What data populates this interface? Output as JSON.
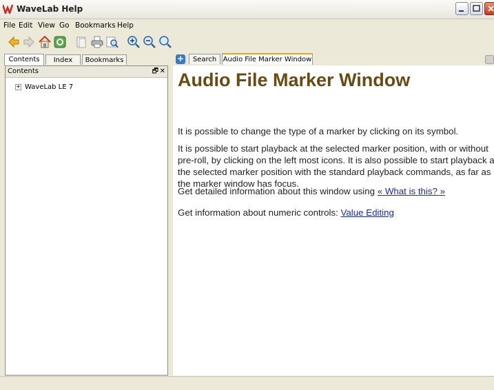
{
  "window": {
    "title": "WaveLab Help"
  },
  "menu": [
    "File",
    "Edit",
    "View",
    "Go",
    "Bookmarks",
    "Help"
  ],
  "toolbar": {
    "icons": [
      "back-arrow-icon",
      "forward-arrow-icon",
      "home-icon",
      "sync-icon",
      "previous-page-icon",
      "print-icon",
      "find-icon",
      "zoom-in-icon",
      "zoom-out-icon",
      "zoom-reset-icon"
    ]
  },
  "left_tabs": [
    "Contents",
    "Index",
    "Bookmarks"
  ],
  "left_panel": {
    "header": "Contents",
    "float_glyph": "🗗",
    "close_glyph": "✕",
    "tree": [
      {
        "expander": "+",
        "label": "WaveLab LE 7"
      }
    ]
  },
  "right_tabs": [
    "Search",
    "Audio File Marker Window"
  ],
  "content": {
    "heading": "Audio File Marker Window",
    "p1": "It is possible to change the type of a marker by clicking on its symbol.",
    "p2": "It is possible to start playback at the selected marker position, with or without pre-roll, by clicking on the left most icons. It is also possible to start playback at the selected marker position with the standard playback commands, as far as the marker window has focus.",
    "p3_text": "Get detailed information about this window using ",
    "p3_link": "« What is this? »",
    "p4_text": "Get information about numeric controls: ",
    "p4_link": "Value Editing"
  }
}
